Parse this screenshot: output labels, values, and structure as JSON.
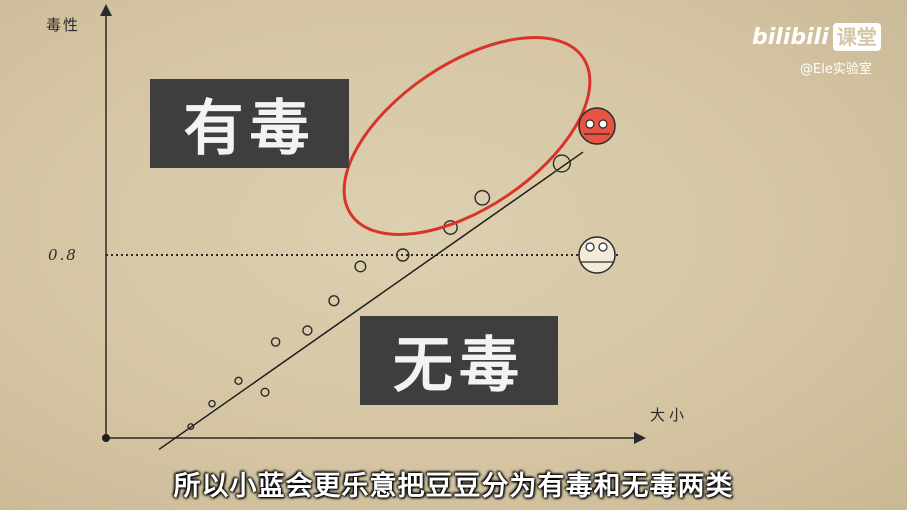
{
  "chart": {
    "y_axis_title": "毒性",
    "x_axis_title": "大小",
    "threshold_label": "0.8",
    "toxic_label": "有毒",
    "nontoxic_label": "无毒"
  },
  "chart_data": {
    "type": "scatter",
    "xlabel": "大小",
    "ylabel": "毒性",
    "threshold_y": 0.8,
    "points": [
      {
        "x": 0.16,
        "y": 0.05
      },
      {
        "x": 0.2,
        "y": 0.15
      },
      {
        "x": 0.25,
        "y": 0.25
      },
      {
        "x": 0.3,
        "y": 0.2
      },
      {
        "x": 0.32,
        "y": 0.42
      },
      {
        "x": 0.38,
        "y": 0.47
      },
      {
        "x": 0.43,
        "y": 0.6
      },
      {
        "x": 0.48,
        "y": 0.75
      },
      {
        "x": 0.56,
        "y": 0.8
      },
      {
        "x": 0.65,
        "y": 0.92
      },
      {
        "x": 0.71,
        "y": 1.05
      },
      {
        "x": 0.86,
        "y": 1.2
      }
    ],
    "trend_line": {
      "x1": 0.1,
      "y1": -0.05,
      "x2": 0.9,
      "y2": 1.25
    },
    "highlight": "ellipse around points above threshold"
  },
  "colors": {
    "background": "#d6c7a6",
    "label_box": "#3e3e3e",
    "highlight_ellipse": "#d9342b",
    "toxic_bean": "#e85443",
    "nontoxic_bean": "#f3ead8"
  },
  "subtitle": "所以小蓝会更乐意把豆豆分为有毒和无毒两类",
  "logo": {
    "brand": "bilibili",
    "badge": "课堂"
  },
  "watermark": "@Ele实验室"
}
